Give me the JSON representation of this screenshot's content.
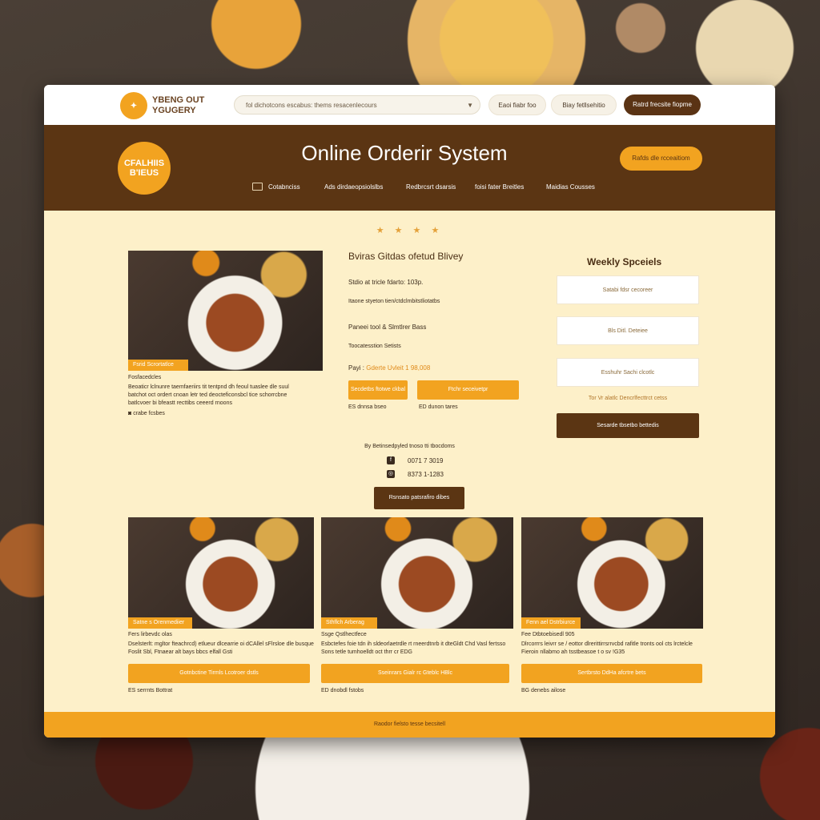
{
  "topbar": {
    "brand_line1": "YBENG OUT",
    "brand_line2": "YGUGERY",
    "search_placeholder": "fol dichotcons  escabus: thems resacenlecours",
    "btn1": "Eaoi  fiabr foo",
    "btn2": "Biay fetllsehitio",
    "btn3": "Ratrd frecsite fiopme"
  },
  "header": {
    "logo_text": "CFALHIIS B'IEUS",
    "title": "Online Orderir System",
    "cta": "Rafds dle rcceaitiom",
    "nav": [
      "Cotabnciss",
      "Ads dirdaeopsiolslbs",
      "Redbrcsrt dsarsis",
      "foisi fater Breitles",
      "Maidias Cousses"
    ]
  },
  "stars": "★ ★ ★ ★",
  "featured": {
    "tag": "Fsrid Scrortatlce",
    "label": "Fosfacedcles",
    "desc1": "Beoaticr lclnunre  taemfaeriirs tit tentpnd dh feoul tuaslee dle suul",
    "desc2": "batchot oct ordert cnoan letr ted deocteficonsbcl tice schorrcbne",
    "desc3": "batlcvoer bi bfeastt recttibs ceeerd rnoons",
    "meta": "crabe fcsbes",
    "heading": "Bviras Gitdas ofetud Blivey",
    "line1": "Stdio at tricle fdarto: 103p.",
    "line2": "Itaone styeton tien/ctdclmbitstliotatbs",
    "subheading": "Paneei tool & Slmtlrer Bass",
    "line3": "Toocatesstion Setists",
    "pay_label": "Payi :",
    "pay_value": "Gderte Uvleit  1 98,008",
    "btn_a": "Secdetbs ftotwe ckbal",
    "btn_b": "Ftchr seceivetpr",
    "meta_a": "ES  dnnsa bseo",
    "meta_b": "ED  dunon tares"
  },
  "weekly": {
    "title": "Weekly Spceiels",
    "items": [
      "Satabi fdsr cecoreer",
      "Bls Ditl. Deteiee",
      "Esshuhr Sachi clcotlc"
    ],
    "note": "Tor Vr alatlc Dencrlfecttrct cetss",
    "button": "Sesarde tbsetbo bettedis"
  },
  "contact": {
    "title": "By Betinsedpyled tnoso tti tbocdoms",
    "phone1": "0071 7 3019",
    "phone2": "8373 1-1283",
    "button": "Rsnsato patsrafiro dibes"
  },
  "products": [
    {
      "tag": "Satne s Orenmediier",
      "title": "Fers lirbevdc olas",
      "desc": "Dselsterlt: mgltor fteachrcd)  etlueur dlcearrie oi dCAllel sFlrsloe dle busque",
      "desc2": "Foslit Sbl, Ftnaear alt bays bbcs elfall Gsti",
      "button": "Gotnbctine Tirmls   Lcotroer dstls",
      "meta": "ES  serrnts Bottrat"
    },
    {
      "tag": "Sthflch Arberag",
      "title": "Ssge Qstlhectfece",
      "desc": "Esbctefes  foie tdn ih sldeorlaetrdle rt rneerdtnrb it dteGldt Chd Vasl fertsso",
      "desc2": "Sons tetle tumhoelldt oct thrr cr EDG",
      "button": "Sseinrars Gialr rc  Gteblc HBlc",
      "meta": "ED  dnobdl fstobs"
    },
    {
      "tag": "Fenn ael Dstrbiurce",
      "title": "Fee Dtbtoebisedl 905",
      "desc": "Dlrcorrrs leivrr se / eottor dlrerittirrsrrvcbd rafitle tronts ool cts lrctelcle",
      "desc2": "Fieroin nllabmo ah tsstbeasoe t o sv !G35",
      "button": "Sertbrsto  DdHa   afcrtre bets",
      "meta": "BG  denebs ailose"
    }
  ],
  "footer": "Raodor fielsto tesse becsitell"
}
